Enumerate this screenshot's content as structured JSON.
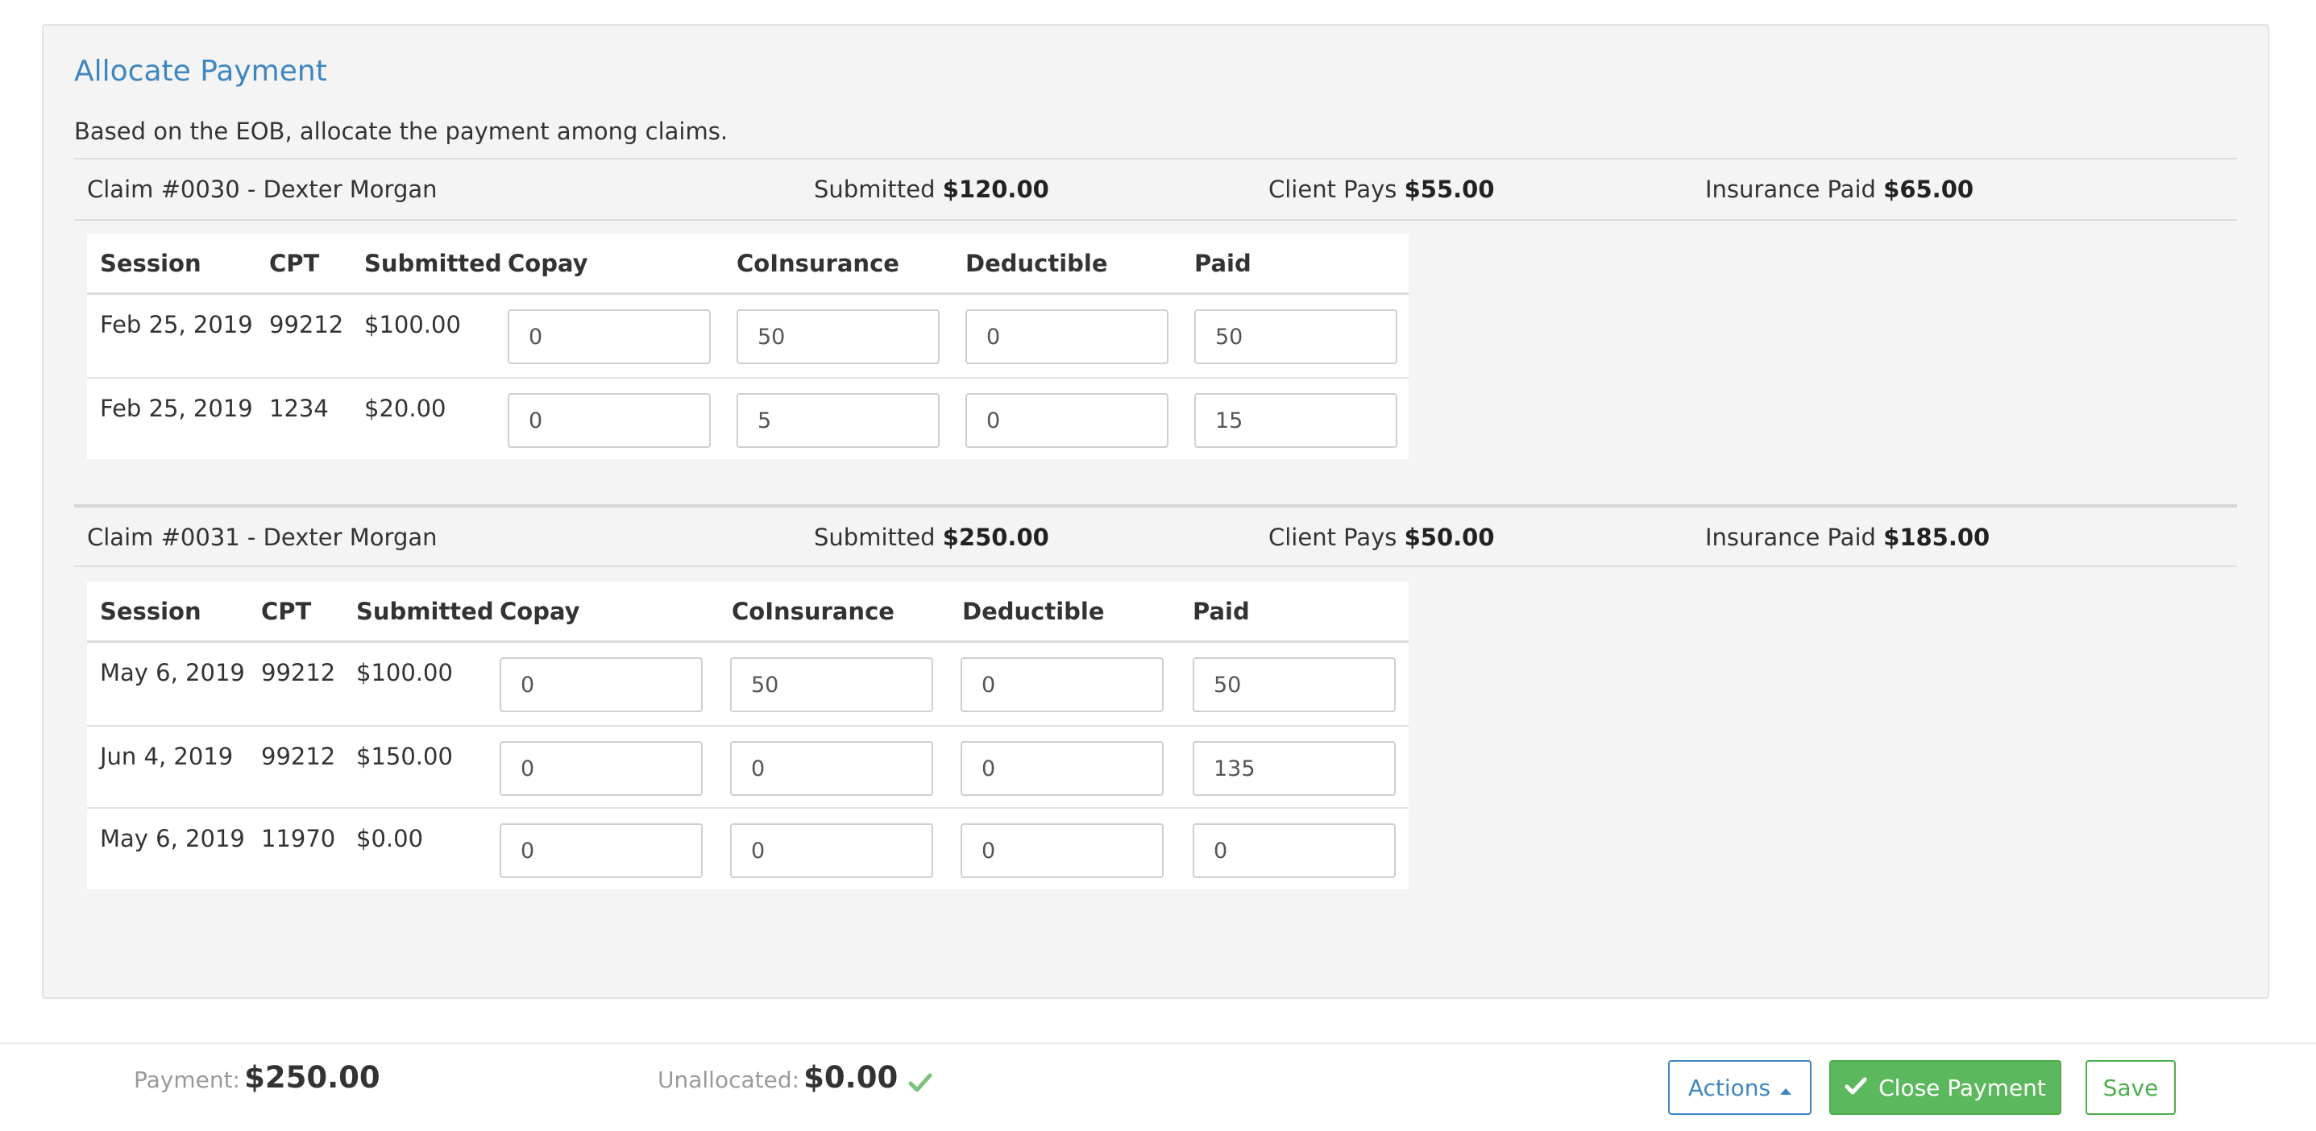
{
  "panel": {
    "title": "Allocate Payment",
    "description": "Based on the EOB, allocate the payment among claims."
  },
  "columns": {
    "session": "Session",
    "cpt": "CPT",
    "submitted": "Submitted",
    "copay": "Copay",
    "coinsurance": "CoInsurance",
    "deductible": "Deductible",
    "paid": "Paid"
  },
  "claims": [
    {
      "title": "Claim #0030 - Dexter Morgan",
      "submitted_label": "Submitted",
      "submitted_value": "$120.00",
      "client_pays_label": "Client Pays",
      "client_pays_value": "$55.00",
      "insurance_paid_label": "Insurance Paid",
      "insurance_paid_value": "$65.00",
      "lines": [
        {
          "session": "Feb 25, 2019",
          "cpt": "99212",
          "submitted": "$100.00",
          "copay": "0",
          "coinsurance": "50",
          "deductible": "0",
          "paid": "50"
        },
        {
          "session": "Feb 25, 2019",
          "cpt": "1234",
          "submitted": "$20.00",
          "copay": "0",
          "coinsurance": "5",
          "deductible": "0",
          "paid": "15"
        }
      ]
    },
    {
      "title": "Claim #0031 - Dexter Morgan",
      "submitted_label": "Submitted",
      "submitted_value": "$250.00",
      "client_pays_label": "Client Pays",
      "client_pays_value": "$50.00",
      "insurance_paid_label": "Insurance Paid",
      "insurance_paid_value": "$185.00",
      "lines": [
        {
          "session": "May 6, 2019",
          "cpt": "99212",
          "submitted": "$100.00",
          "copay": "0",
          "coinsurance": "50",
          "deductible": "0",
          "paid": "50"
        },
        {
          "session": "Jun 4, 2019",
          "cpt": "99212",
          "submitted": "$150.00",
          "copay": "0",
          "coinsurance": "0",
          "deductible": "0",
          "paid": "135"
        },
        {
          "session": "May 6, 2019",
          "cpt": "11970",
          "submitted": "$0.00",
          "copay": "0",
          "coinsurance": "0",
          "deductible": "0",
          "paid": "0"
        }
      ]
    }
  ],
  "footer": {
    "payment_label": "Payment:",
    "payment_value": "$250.00",
    "unallocated_label": "Unallocated:",
    "unallocated_value": "$0.00",
    "unallocated_status_icon": "check-icon",
    "actions_label": "Actions",
    "close_payment_label": "Close Payment",
    "save_label": "Save"
  },
  "colors": {
    "title_blue": "#3f86c1",
    "success_green": "#5cb85c",
    "panel_bg": "#f4f4f4"
  }
}
